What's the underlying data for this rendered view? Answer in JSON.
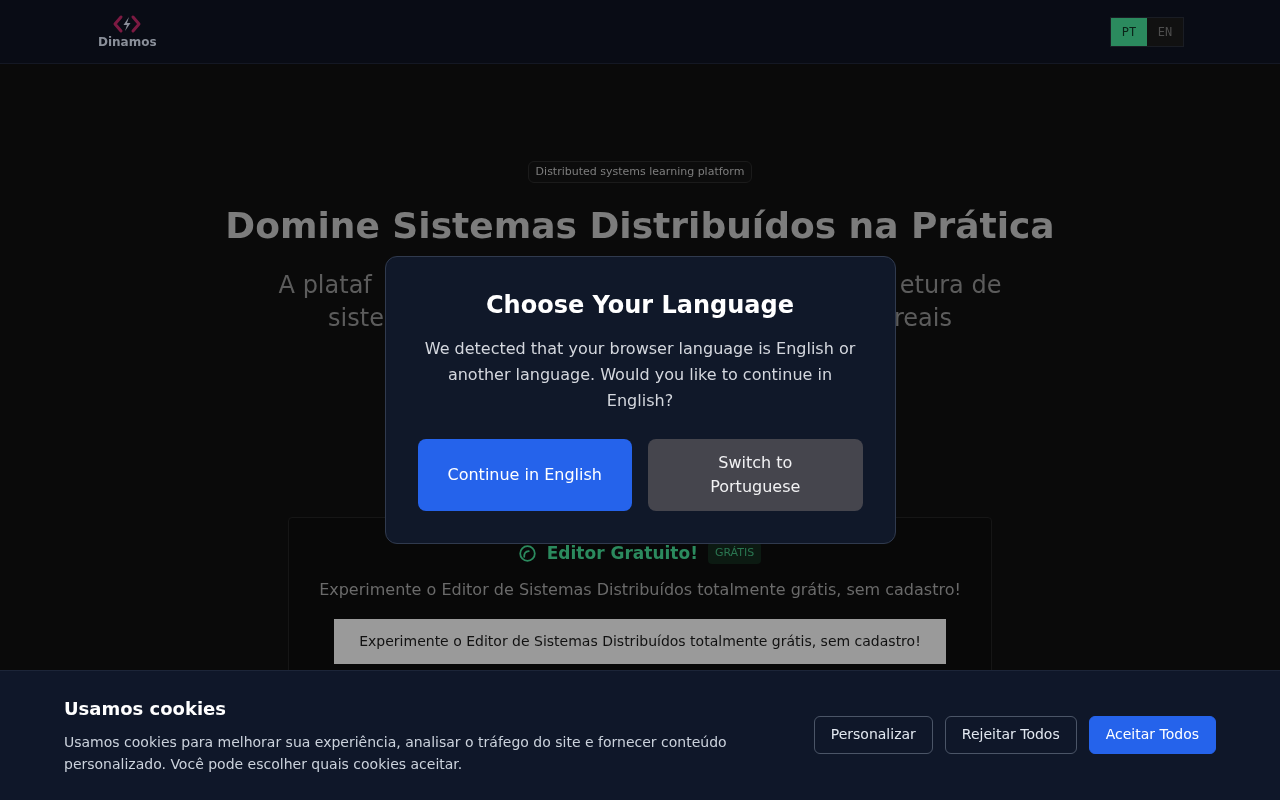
{
  "header": {
    "logo": {
      "name": "Dinamos"
    },
    "language_switcher": [
      {
        "label": "PT",
        "selected": true
      },
      {
        "label": "EN",
        "selected": false
      }
    ]
  },
  "hero": {
    "badge": "Distributed systems learning platform",
    "title": "Domine Sistemas Distribuídos na Prática",
    "subtitle_visible_parts": [
      {
        "left": "A plataf",
        "right": "etura de"
      },
      {
        "left": "siste",
        "right": "reais"
      }
    ]
  },
  "free_editor_card": {
    "title": "Editor Gratuito!",
    "badge": "GRÁTIS",
    "description": "Experimente o Editor de Sistemas Distribuídos totalmente grátis, sem cadastro!",
    "banner": "Experimente o Editor de Sistemas Distribuídos totalmente grátis, sem cadastro!"
  },
  "language_dialog": {
    "title": "Choose Your Language",
    "message": "We detected that your browser language is English or another language. Would you like to continue in English?",
    "buttons": [
      {
        "label": "Continue in English",
        "kind": "primary"
      },
      {
        "label": "Switch to Portuguese",
        "kind": "secondary"
      }
    ]
  },
  "cookie_banner": {
    "title": "Usamos cookies",
    "message": "Usamos cookies para melhorar sua experiência, analisar o tráfego do site e fornecer conteúdo personalizado. Você pode escolher quais cookies aceitar.",
    "buttons": [
      {
        "label": "Personalizar",
        "kind": "outline"
      },
      {
        "label": "Rejeitar Todos",
        "kind": "outline"
      },
      {
        "label": "Aceitar Todos",
        "kind": "primary"
      }
    ]
  }
}
